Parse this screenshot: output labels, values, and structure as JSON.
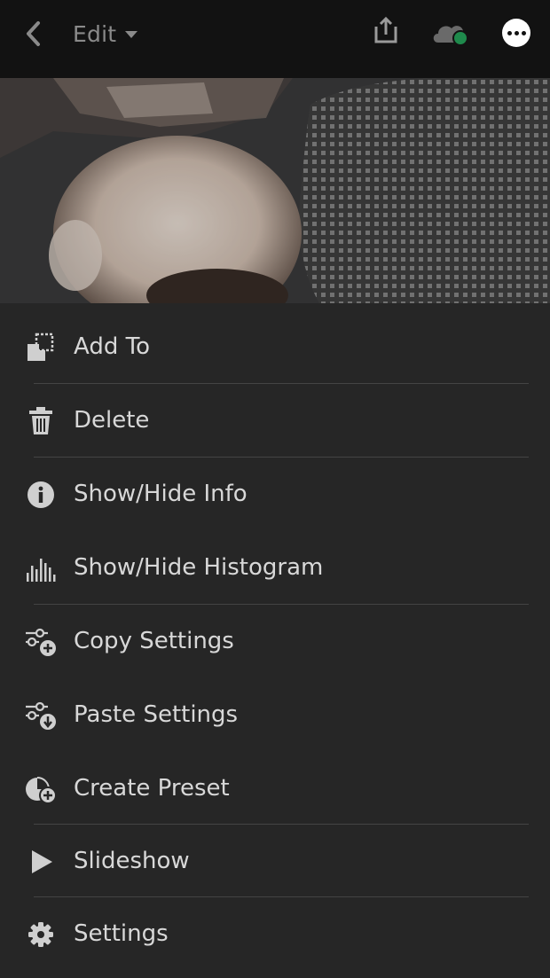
{
  "header": {
    "edit_label": "Edit",
    "icons": [
      "back-icon",
      "share-icon",
      "cloud-sync-icon",
      "more-options-icon"
    ],
    "sync_status_color": "#1f8a4c"
  },
  "menu": {
    "items": [
      {
        "label": "Add To",
        "icon": "add-to-album-icon"
      },
      {
        "label": "Delete",
        "icon": "trash-icon"
      },
      {
        "label": "Show/Hide Info",
        "icon": "info-icon"
      },
      {
        "label": "Show/Hide Histogram",
        "icon": "histogram-icon"
      },
      {
        "label": "Copy Settings",
        "icon": "copy-settings-icon"
      },
      {
        "label": "Paste Settings",
        "icon": "paste-settings-icon"
      },
      {
        "label": "Create Preset",
        "icon": "create-preset-icon"
      },
      {
        "label": "Slideshow",
        "icon": "play-icon"
      },
      {
        "label": "Settings",
        "icon": "gear-icon"
      }
    ]
  },
  "colors": {
    "topbar": "#121212",
    "sheet": "#262626",
    "text": "#d8d8d8"
  }
}
